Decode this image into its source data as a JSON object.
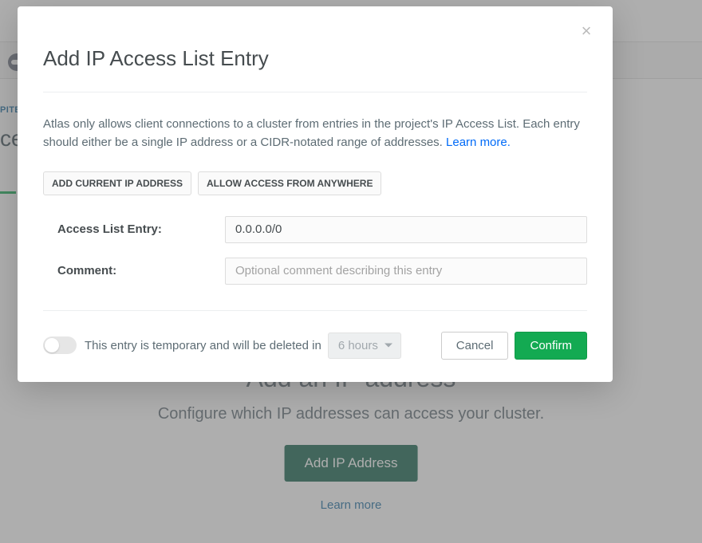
{
  "background": {
    "breadcrumb": "PITE",
    "heading_fragment": "ce",
    "title": "Add an IP address",
    "subtitle": "Configure which IP addresses can access your cluster.",
    "cta": "Add IP Address",
    "learn": "Learn more"
  },
  "modal": {
    "title": "Add IP Access List Entry",
    "desc_start": "Atlas only allows client connections to a cluster from entries in the project's IP Access List. Each entry should either be a single IP address or a CIDR-notated range of addresses. ",
    "learn_more": "Learn more.",
    "helpers": {
      "add_current": "ADD CURRENT IP ADDRESS",
      "allow_anywhere": "ALLOW ACCESS FROM ANYWHERE"
    },
    "form": {
      "entry_label": "Access List Entry:",
      "entry_value": "0.0.0.0/0",
      "comment_label": "Comment:",
      "comment_placeholder": "Optional comment describing this entry"
    },
    "footer": {
      "temp_label": "This entry is temporary and will be deleted in",
      "duration": "6 hours",
      "cancel": "Cancel",
      "confirm": "Confirm"
    }
  }
}
